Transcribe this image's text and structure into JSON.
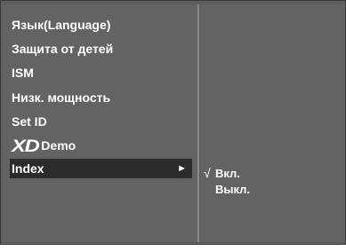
{
  "menu": {
    "items": [
      {
        "label": "Язык(Language)"
      },
      {
        "label": "Защита от детей"
      },
      {
        "label": "ISM"
      },
      {
        "label": "Низк. мощность"
      },
      {
        "label": "Set ID"
      },
      {
        "logo": "XD",
        "label": "Demo"
      },
      {
        "label": "Index",
        "arrow": "►",
        "selected": true
      }
    ]
  },
  "submenu": {
    "check_mark": "√",
    "options": [
      {
        "label": "Вкл.",
        "checked": true
      },
      {
        "label": "Выкл.",
        "checked": false
      }
    ]
  },
  "colors": {
    "panel": "#636363",
    "highlight": "#2b2b2b",
    "text": "#ffffff"
  }
}
